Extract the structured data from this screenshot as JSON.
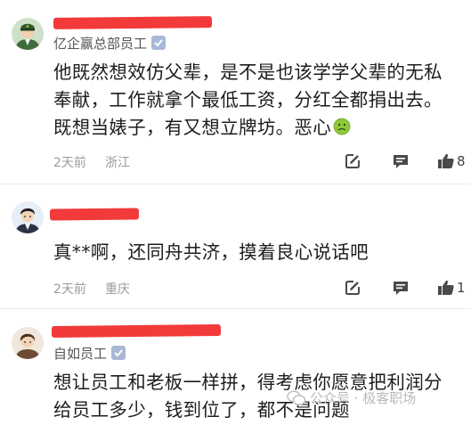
{
  "comments": [
    {
      "badge": "亿企赢总部员工",
      "lines": [
        "他既然想效仿父辈，是不是也该学学父辈的无私",
        "奉献，工作就拿个最低工资，分红全都捐出去。",
        "既想当婊子，有又想立牌坊。恶心"
      ],
      "emoji": "nauseated-face-emoji",
      "time": "2天前",
      "location": "浙江",
      "likes": "8"
    },
    {
      "lines": [
        "真**啊，还同舟共济，摸着良心说话吧"
      ],
      "time": "2天前",
      "location": "重庆",
      "likes": "1"
    },
    {
      "badge": "自如员工",
      "lines": [
        "想让员工和老板一样拼，得考虑你愿意把利润分",
        "给员工多少，钱到位了，都不是问题"
      ]
    }
  ],
  "watermark": {
    "text": "公众号 · 极客职场",
    "icon": "wechat-official-account-icon"
  },
  "colors": {
    "redaction": "#f23a3a",
    "verified_badge": "#a9b8d6",
    "meta_gray": "#9a9a9a",
    "action_icon": "#4a4a4a"
  }
}
